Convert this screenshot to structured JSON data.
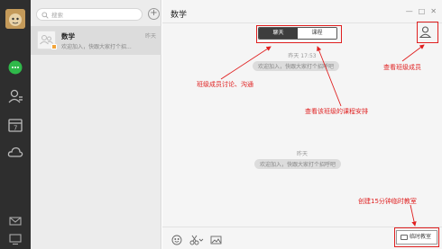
{
  "colors": {
    "rail": "#2e2e2e",
    "list_bg": "#ececec",
    "chat_bg": "#f5f5f5",
    "annotation": "#e02020",
    "tab_active": "#3d3d3d",
    "online_green": "#2fb94a"
  },
  "search": {
    "placeholder": "搜索"
  },
  "conversation": {
    "name": "数学",
    "time": "昨天",
    "preview": "欢迎加入，快跟大家打个招..."
  },
  "chat": {
    "title": "数学",
    "tabs": [
      {
        "label": "聊天",
        "active": true
      },
      {
        "label": "课程",
        "active": false
      }
    ],
    "timestamp": "昨天 17:53",
    "system_message": "欢迎加入，快跟大家打个招呼吧",
    "timestamp_2": "昨天",
    "system_message_2": "欢迎加入，快跟大家打个招呼吧",
    "classroom_button": "临时教室"
  },
  "window_controls": [
    "—",
    "□",
    "✕"
  ],
  "annotations": {
    "members": "查看班级成员",
    "chat": "班级成员讨论、沟通",
    "course": "查看该班级的课程安排",
    "classroom": "创建15分钟临时教室"
  },
  "icons": {
    "rail": [
      "chat-bubble-icon",
      "contacts-icon",
      "calendar-icon",
      "cloud-icon",
      "mail-icon",
      "device-icon"
    ],
    "toolbar": [
      "emoji-icon",
      "scissors-icon",
      "image-icon"
    ]
  }
}
